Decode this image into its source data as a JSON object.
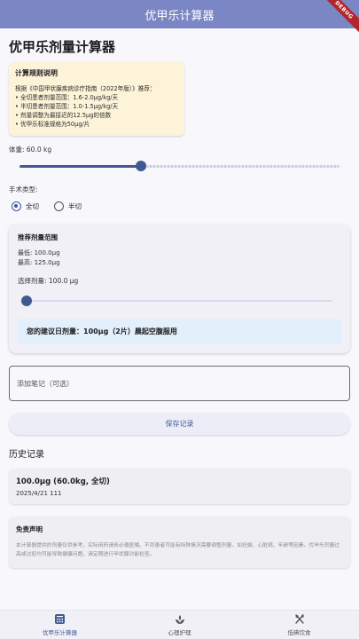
{
  "appbar": {
    "title": "优甲乐计算器",
    "debug_label": "DEBUG"
  },
  "page": {
    "title": "优甲乐剂量计算器"
  },
  "info_card": {
    "title": "计算规则说明",
    "lines": [
      "根据《中国甲状腺疾病诊疗指南（2022年版）》推荐：",
      "• 全切患者剂量范围：1.6-2.0μg/kg/天",
      "• 半切患者剂量范围：1.0-1.5μg/kg/天",
      "• 剂量调整为最接近的12.5μg的倍数",
      "• 优甲乐标准规格为50μg/片"
    ]
  },
  "weight": {
    "label": "体重: 60.0 kg",
    "value_fraction": 0.38
  },
  "surgery": {
    "label": "手术类型:",
    "options": [
      {
        "label": "全切",
        "selected": true
      },
      {
        "label": "半切",
        "selected": false
      }
    ]
  },
  "dose_card": {
    "title": "推荐剂量范围",
    "min_line": "最低: 100.0μg",
    "max_line": "最高: 125.0μg",
    "selected_label": "选择剂量: 100.0 μg",
    "selected_fraction": 0.0,
    "recommendation": "您的建议日剂量：100μg（2片）晨起空腹服用"
  },
  "note": {
    "placeholder": "添加笔记（可选）"
  },
  "save": {
    "label": "保存记录"
  },
  "history": {
    "title": "历史记录",
    "items": [
      {
        "main": "100.0μg (60.0kg, 全切)",
        "sub": "2025/4/21 111"
      }
    ]
  },
  "disclaimer": {
    "title": "免责声明",
    "text": "本计算器提供的剂量仅供参考，实际用药请务必遵医嘱。不同患者可能有特殊情况需要调整剂量，如妊娠、心脏病、年龄等因素。优甲乐剂量过高或过低均可能导致健康问题，请定期进行甲状腺功能检查。"
  },
  "bottom_nav": {
    "items": [
      {
        "label": "优甲乐计算器",
        "icon": "calculator-icon",
        "active": true
      },
      {
        "label": "心理护理",
        "icon": "spa-icon",
        "active": false
      },
      {
        "label": "低碘饮食",
        "icon": "restaurant-icon",
        "active": false
      }
    ]
  },
  "colors": {
    "appbar": "#7b86c4",
    "primary": "#3f5a92",
    "info_card": "#fdf3d9",
    "recommend_bg": "#e3effa"
  }
}
